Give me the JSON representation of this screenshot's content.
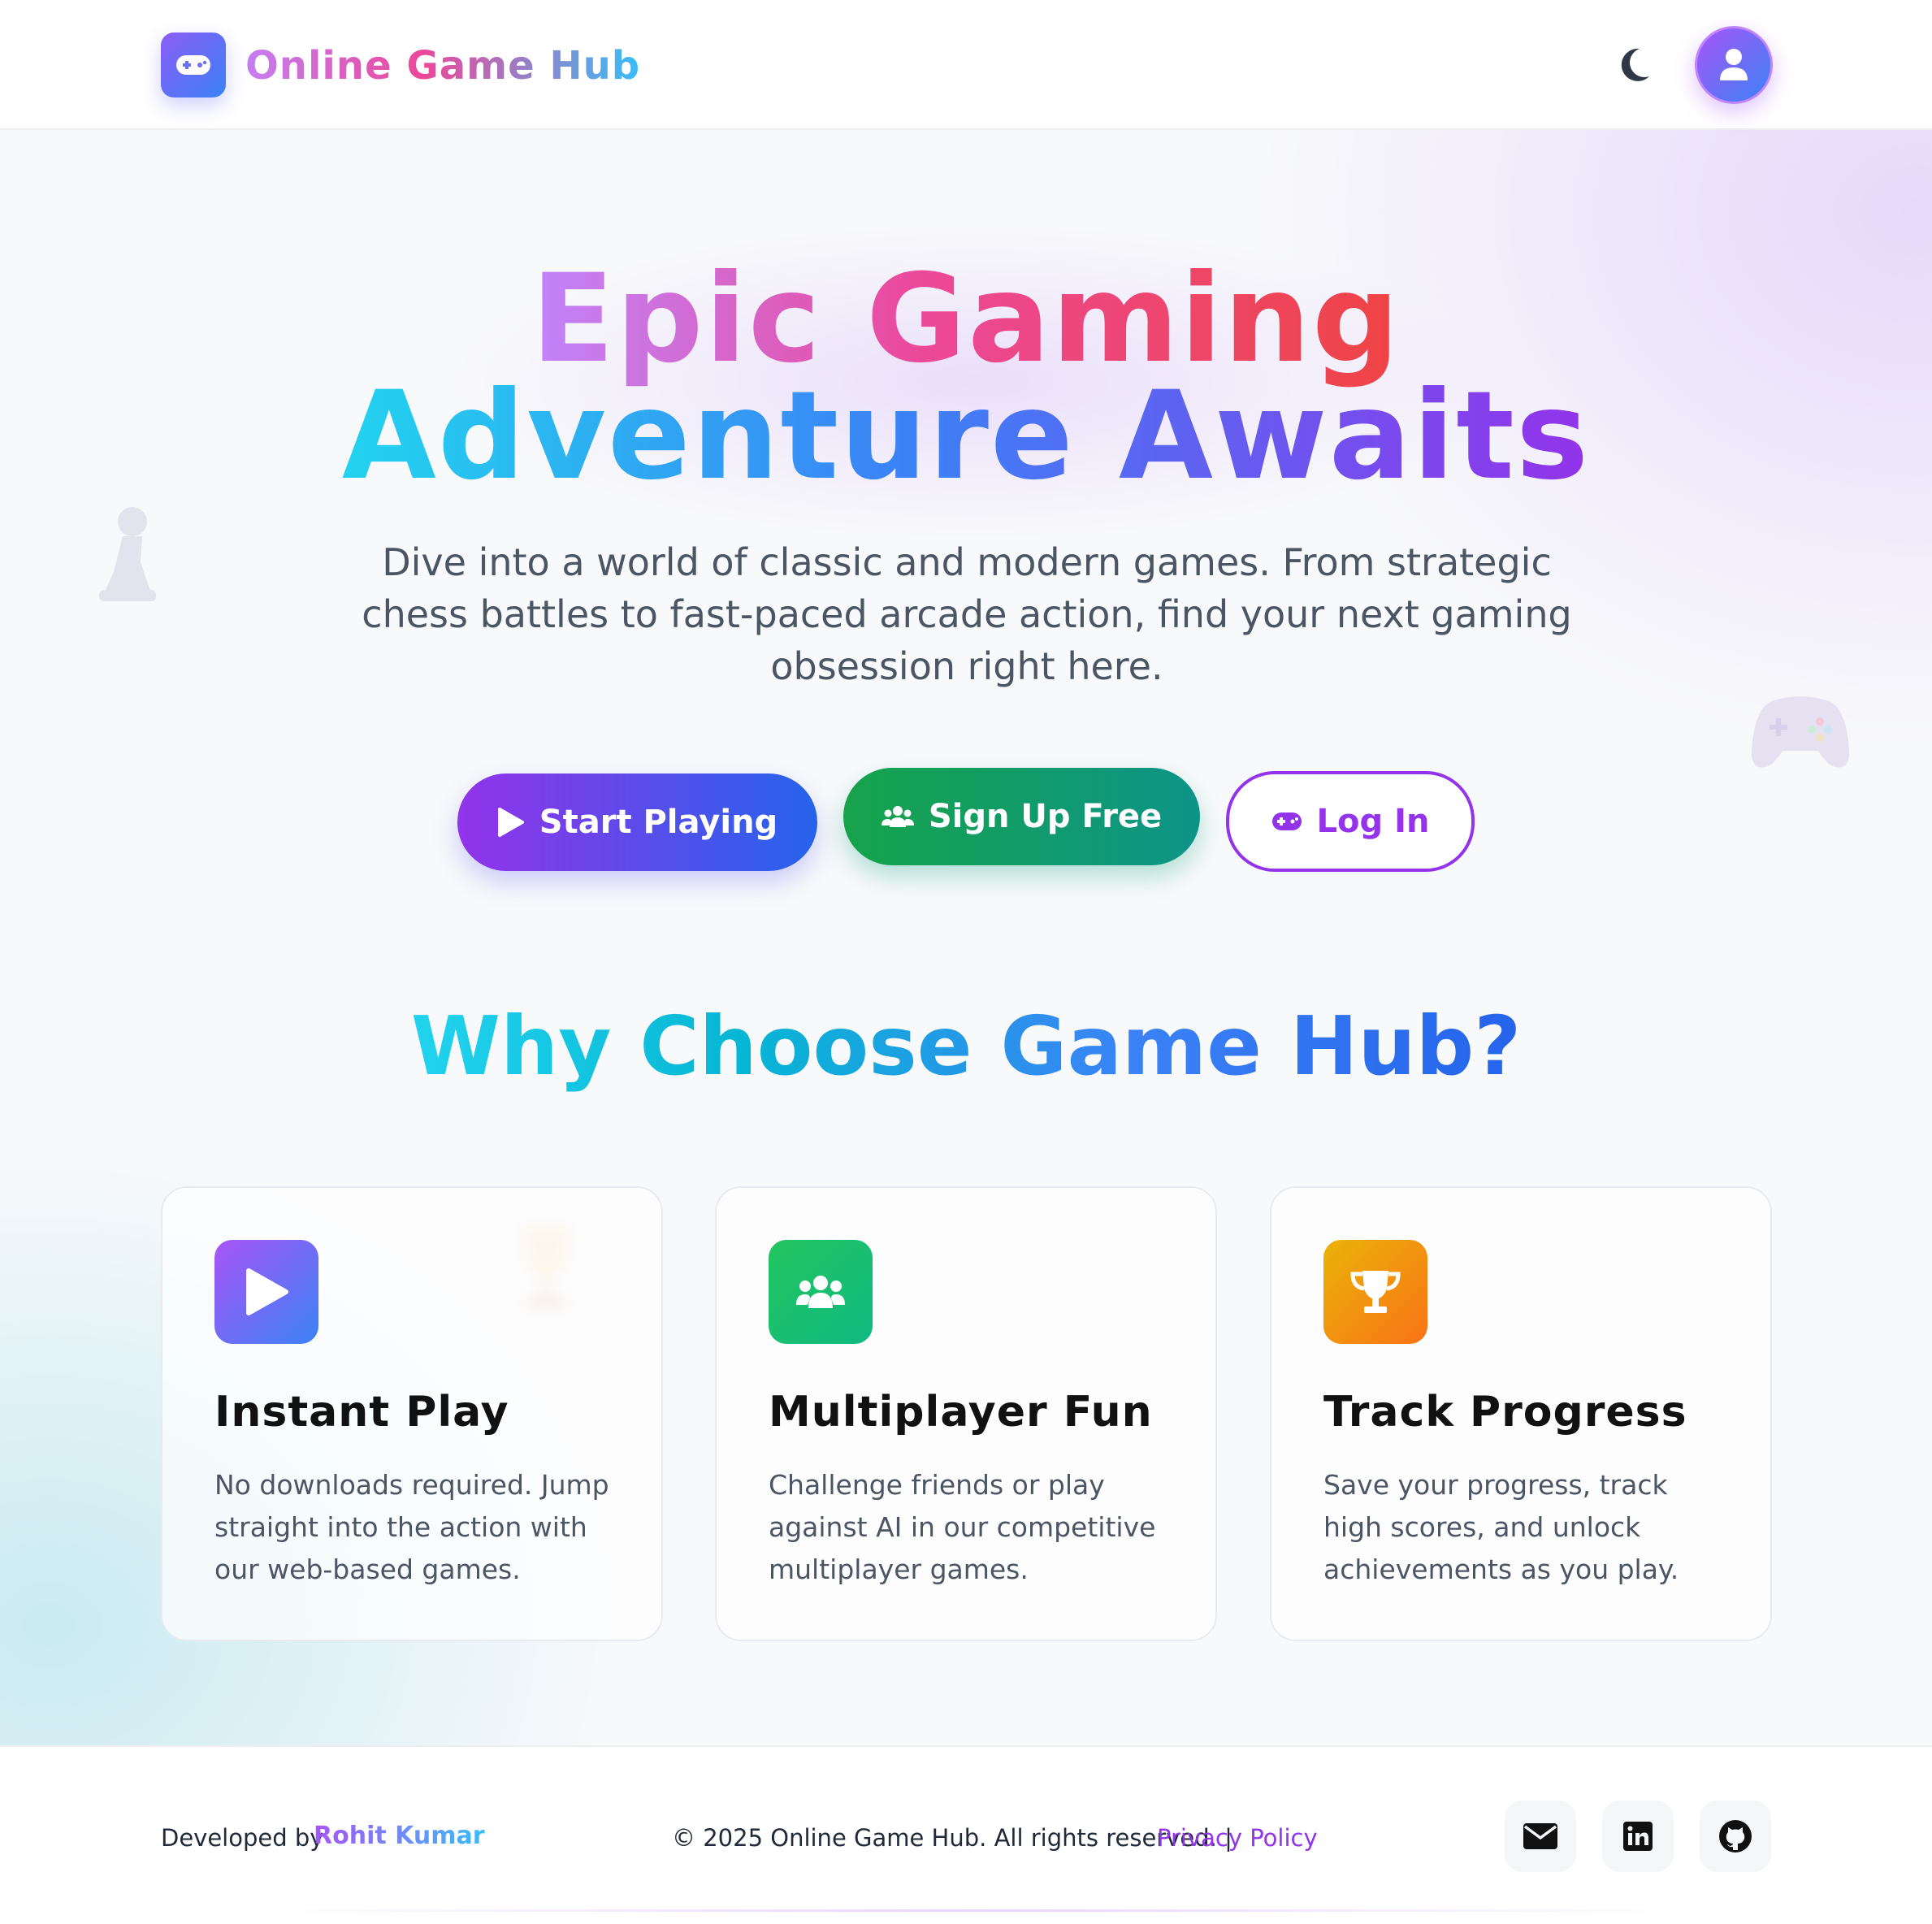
{
  "header": {
    "brand": "Online Game Hub",
    "icons": {
      "logo": "gamepad-icon",
      "theme_toggle": "moon-icon",
      "profile": "user-icon"
    }
  },
  "hero": {
    "title_line1": "Epic Gaming",
    "title_line2": "Adventure Awaits",
    "subtitle": "Dive into a world of classic and modern games. From strategic chess battles to fast-paced arcade action, find your next gaming obsession right here.",
    "buttons": {
      "start": "Start Playing",
      "signup": "Sign Up Free",
      "login": "Log In"
    }
  },
  "features": {
    "title": "Why Choose Game Hub?",
    "cards": [
      {
        "title": "Instant Play",
        "text": "No downloads required. Jump straight into the action with our web-based games.",
        "icon": "play-icon"
      },
      {
        "title": "Multiplayer Fun",
        "text": "Challenge friends or play against AI in our competitive multiplayer games.",
        "icon": "users-icon"
      },
      {
        "title": "Track Progress",
        "text": "Save your progress, track high scores, and unlock achievements as you play.",
        "icon": "trophy-icon"
      }
    ]
  },
  "footer": {
    "developed_by": "Developed by",
    "developer": "Rohit Kumar",
    "copyright": "© 2025 Online Game Hub. All rights reserved. |",
    "privacy": "Privacy Policy",
    "social": [
      "envelope-icon",
      "linkedin-icon",
      "github-icon"
    ]
  },
  "colors": {
    "purple": "#9333ea",
    "blue": "#2563eb",
    "green": "#16a34a",
    "teal": "#0d9488",
    "orange": "#f97316"
  }
}
